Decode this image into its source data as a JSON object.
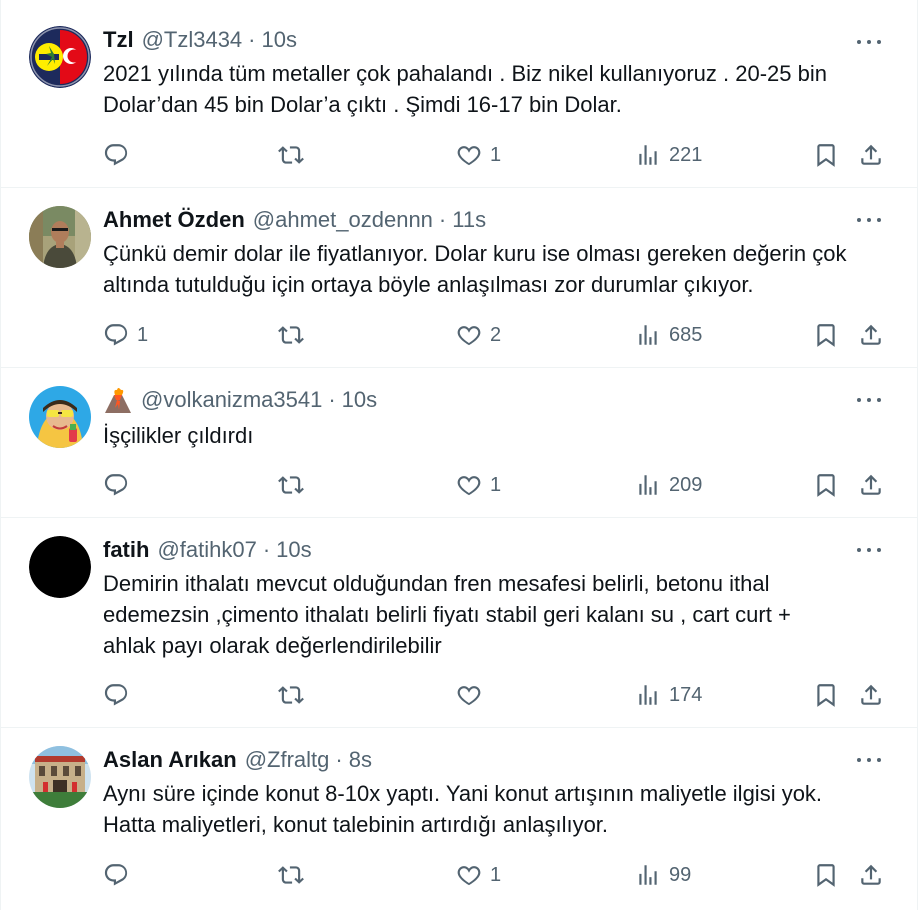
{
  "tweets": [
    {
      "display_name": "Tzl",
      "handle": "@Tzl3434",
      "separator": "·",
      "time": "10s",
      "text_lines": [
        "2021 yılında tüm metaller çok pahalandı . Biz nikel kullanıyoruz . 20-25  bin",
        "Dolar’dan 45 bin Dolar’a çıktı . Şimdi 16-17 bin Dolar."
      ],
      "replies": "",
      "retweets": "",
      "likes": "1",
      "views": "221"
    },
    {
      "display_name": "Ahmet Özden",
      "handle": "@ahmet_ozdennn",
      "separator": "·",
      "time": "11s",
      "text_lines": [
        "Çünkü demir dolar ile fiyatlanıyor. Dolar kuru ise olması gereken değerin çok",
        "altında tutulduğu için ortaya böyle anlaşılması zor durumlar çıkıyor."
      ],
      "replies": "1",
      "retweets": "",
      "likes": "2",
      "views": "685"
    },
    {
      "display_name": "",
      "handle": "@volkanizma3541",
      "separator": "·",
      "time": "10s",
      "name_icon": "volcano-emoji-icon",
      "text_lines": [
        "İşçilikler çıldırdı"
      ],
      "replies": "",
      "retweets": "",
      "likes": "1",
      "views": "209"
    },
    {
      "display_name": "fatih",
      "handle": "@fatihk07",
      "separator": "·",
      "time": "10s",
      "text_lines": [
        "Demirin ithalatı mevcut olduğundan fren mesafesi belirli, betonu ithal",
        "edemezsin ,çimento ithalatı belirli fiyatı stabil geri kalanı su , cart curt +",
        "ahlak payı olarak değerlendirilebilir"
      ],
      "replies": "",
      "retweets": "",
      "likes": "",
      "views": "174"
    },
    {
      "display_name": "Aslan Arıkan",
      "handle": "@Zfraltg",
      "separator": "·",
      "time": "8s",
      "text_lines": [
        "Aynı süre içinde konut 8-10x yaptı. Yani konut artışının maliyetle ilgisi yok.",
        "Hatta maliyetleri, konut talebinin artırdığı anlaşılıyor."
      ],
      "replies": "",
      "retweets": "",
      "likes": "1",
      "views": "99"
    }
  ],
  "icons": {
    "reply": "reply-icon",
    "retweet": "retweet-icon",
    "like": "like-icon",
    "views": "views-icon",
    "bookmark": "bookmark-icon",
    "share": "share-icon",
    "more": "more-icon"
  },
  "colors": {
    "text": "#0f1419",
    "secondary": "#536471",
    "border": "#eff3f4"
  }
}
